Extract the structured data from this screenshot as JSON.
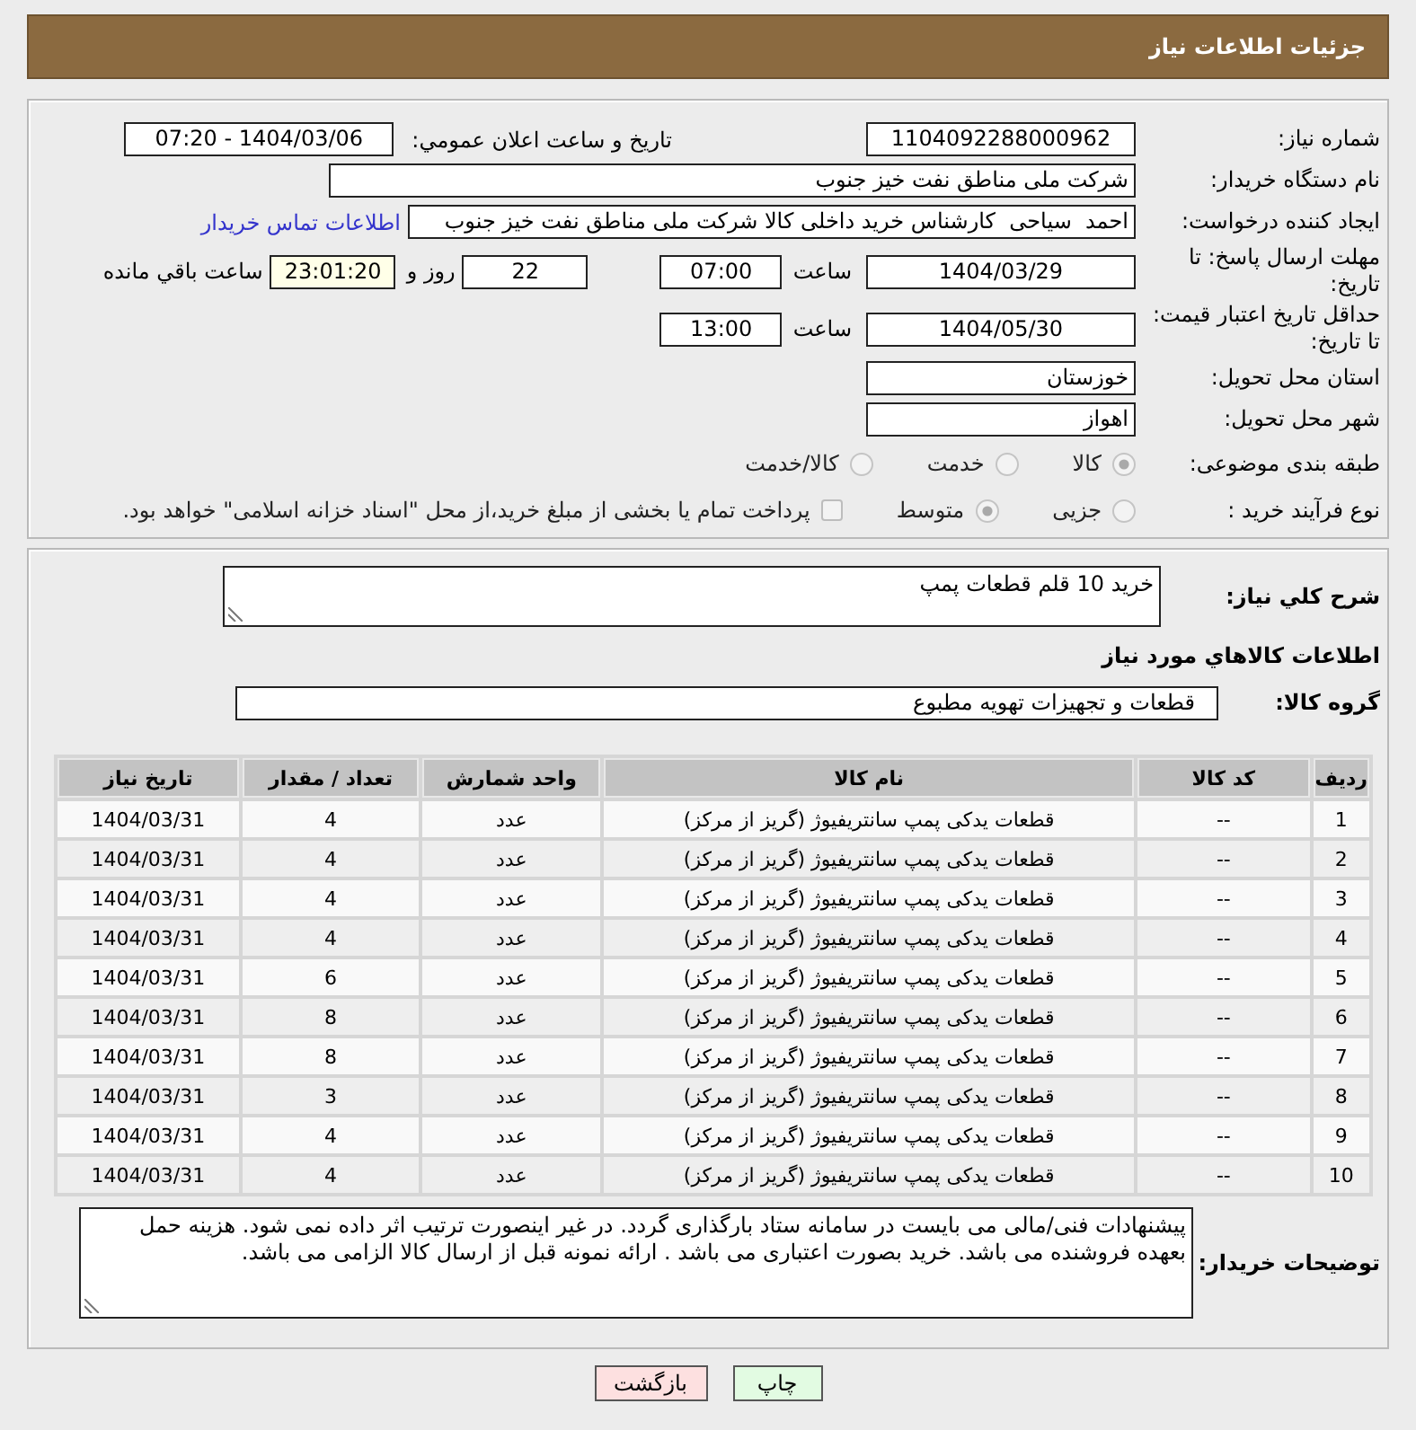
{
  "header": {
    "title": "جزئیات اطلاعات نیاز"
  },
  "details": {
    "need_number": {
      "label": "شماره نیاز:",
      "value": "1104092288000962"
    },
    "announcement": {
      "label": "تاریخ و ساعت اعلان عمومي:",
      "value": "1404/03/06 - 07:20"
    },
    "buyer_org": {
      "label": "نام دستگاه خریدار:",
      "value": "شرکت ملی مناطق نفت خیز جنوب"
    },
    "requester": {
      "label": "ایجاد کننده درخواست:",
      "value": "احمد  سیاحی  کارشناس خرید داخلی کالا شرکت ملی مناطق نفت خیز جنوب",
      "link": "اطلاعات تماس خریدار"
    },
    "response_deadline": {
      "label": "مهلت ارسال پاسخ: تا تاریخ:",
      "date": "1404/03/29",
      "time_label": "ساعت",
      "time": "07:00",
      "days": "22",
      "days_label": "روز و",
      "remaining": "23:01:20",
      "remaining_label": "ساعت باقي مانده"
    },
    "price_validity": {
      "label": "حداقل تاریخ اعتبار قیمت: تا تاریخ:",
      "date": "1404/05/30",
      "time_label": "ساعت",
      "time": "13:00"
    },
    "province": {
      "label": "استان محل تحویل:",
      "value": "خوزستان"
    },
    "city": {
      "label": "شهر محل تحویل:",
      "value": "اهواز"
    },
    "category": {
      "label": "طبقه بندی موضوعی:",
      "options": [
        {
          "label": "کالا",
          "selected": true
        },
        {
          "label": "خدمت",
          "selected": false
        },
        {
          "label": "کالا/خدمت",
          "selected": false
        }
      ]
    },
    "process": {
      "label": "نوع فرآیند خرید :",
      "options": [
        {
          "label": "جزیی",
          "selected": false
        },
        {
          "label": "متوسط",
          "selected": true
        }
      ],
      "treasury": {
        "label": "پرداخت تمام یا بخشی از مبلغ خرید،از محل \"اسناد خزانه اسلامی\" خواهد بود.",
        "checked": false
      }
    }
  },
  "description": {
    "label": "شرح کلي نياز:",
    "value": "خرید 10 قلم قطعات پمپ"
  },
  "goods": {
    "title": "اطلاعات کالاهاي مورد نياز",
    "group": {
      "label": "گروه کالا:",
      "value": "قطعات و تجهیزات تهویه مطبوع"
    },
    "table": {
      "columns": [
        "ردیف",
        "کد کالا",
        "نام کالا",
        "واحد شمارش",
        "تعداد / مقدار",
        "تاریخ نیاز"
      ],
      "rows": [
        [
          "1",
          "--",
          "قطعات یدکی پمپ سانتریفیوژ (گریز از مرکز)",
          "عدد",
          "4",
          "1404/03/31"
        ],
        [
          "2",
          "--",
          "قطعات یدکی پمپ سانتریفیوژ (گریز از مرکز)",
          "عدد",
          "4",
          "1404/03/31"
        ],
        [
          "3",
          "--",
          "قطعات یدکی پمپ سانتریفیوژ (گریز از مرکز)",
          "عدد",
          "4",
          "1404/03/31"
        ],
        [
          "4",
          "--",
          "قطعات یدکی پمپ سانتریفیوژ (گریز از مرکز)",
          "عدد",
          "4",
          "1404/03/31"
        ],
        [
          "5",
          "--",
          "قطعات یدکی پمپ سانتریفیوژ (گریز از مرکز)",
          "عدد",
          "6",
          "1404/03/31"
        ],
        [
          "6",
          "--",
          "قطعات یدکی پمپ سانتریفیوژ (گریز از مرکز)",
          "عدد",
          "8",
          "1404/03/31"
        ],
        [
          "7",
          "--",
          "قطعات یدکی پمپ سانتریفیوژ (گریز از مرکز)",
          "عدد",
          "8",
          "1404/03/31"
        ],
        [
          "8",
          "--",
          "قطعات یدکی پمپ سانتریفیوژ (گریز از مرکز)",
          "عدد",
          "3",
          "1404/03/31"
        ],
        [
          "9",
          "--",
          "قطعات یدکی پمپ سانتریفیوژ (گریز از مرکز)",
          "عدد",
          "4",
          "1404/03/31"
        ],
        [
          "10",
          "--",
          "قطعات یدکی پمپ سانتریفیوژ (گریز از مرکز)",
          "عدد",
          "4",
          "1404/03/31"
        ]
      ]
    }
  },
  "buyer_notes": {
    "label": "توضیحات خریدار:",
    "value": "پیشنهادات فنی/مالی می بایست در سامانه ستاد بارگذاری گردد. در غیر اینصورت ترتیب اثر داده نمی شود. هزینه حمل بعهده فروشنده می باشد. خرید بصورت اعتباری می باشد . ارائه نمونه قبل از ارسال کالا الزامی می باشد."
  },
  "buttons": [
    {
      "label": "چاپ",
      "kind": "print"
    },
    {
      "label": "بازگشت",
      "kind": "back"
    }
  ]
}
